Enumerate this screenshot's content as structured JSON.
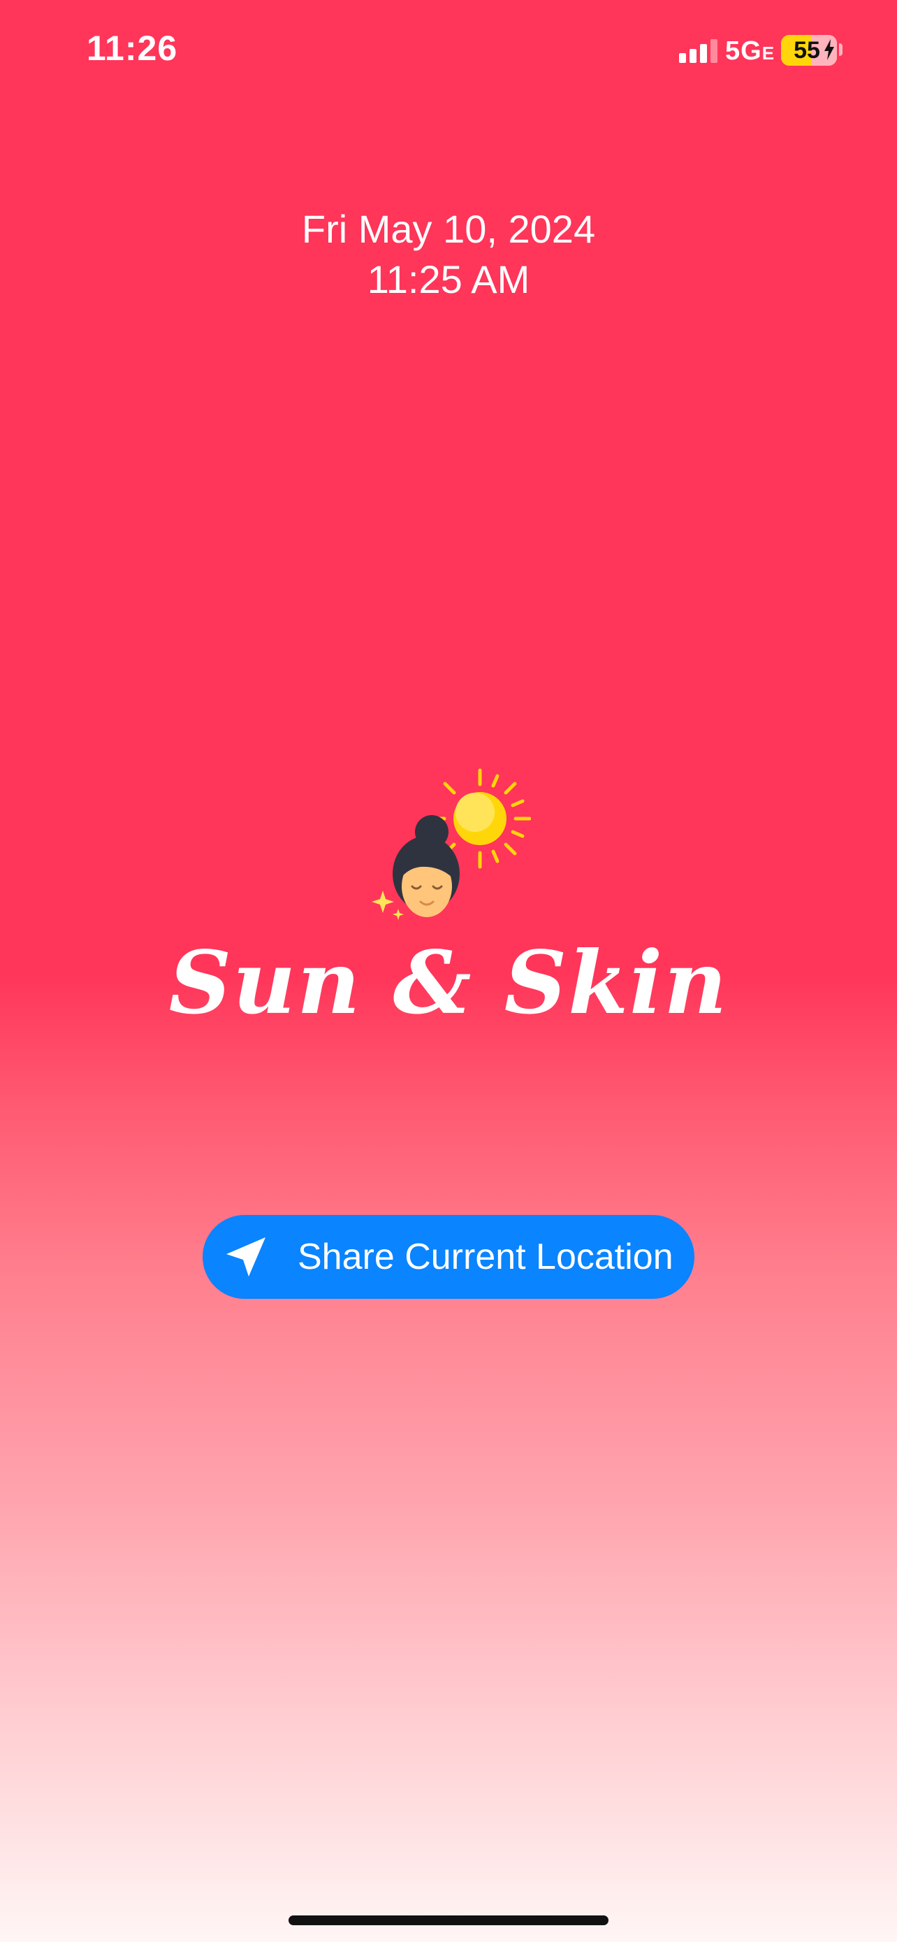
{
  "status_bar": {
    "time": "11:26",
    "network": "5G",
    "network_suffix": "E",
    "battery_percent": 55,
    "battery_label": "55",
    "charging": true
  },
  "header": {
    "date": "Fri May 10, 2024",
    "time": "11:25 AM"
  },
  "logo": {
    "icon": "sun-and-face-icon",
    "title": "Sun & Skin"
  },
  "actions": {
    "share_location_label": "Share Current Location",
    "share_location_icon": "location-arrow-icon"
  },
  "colors": {
    "background_top": "#ff3559",
    "background_bottom": "#fff6f5",
    "button": "#0a84ff",
    "sun": "#ffd60a",
    "battery": "#ffd60a"
  }
}
